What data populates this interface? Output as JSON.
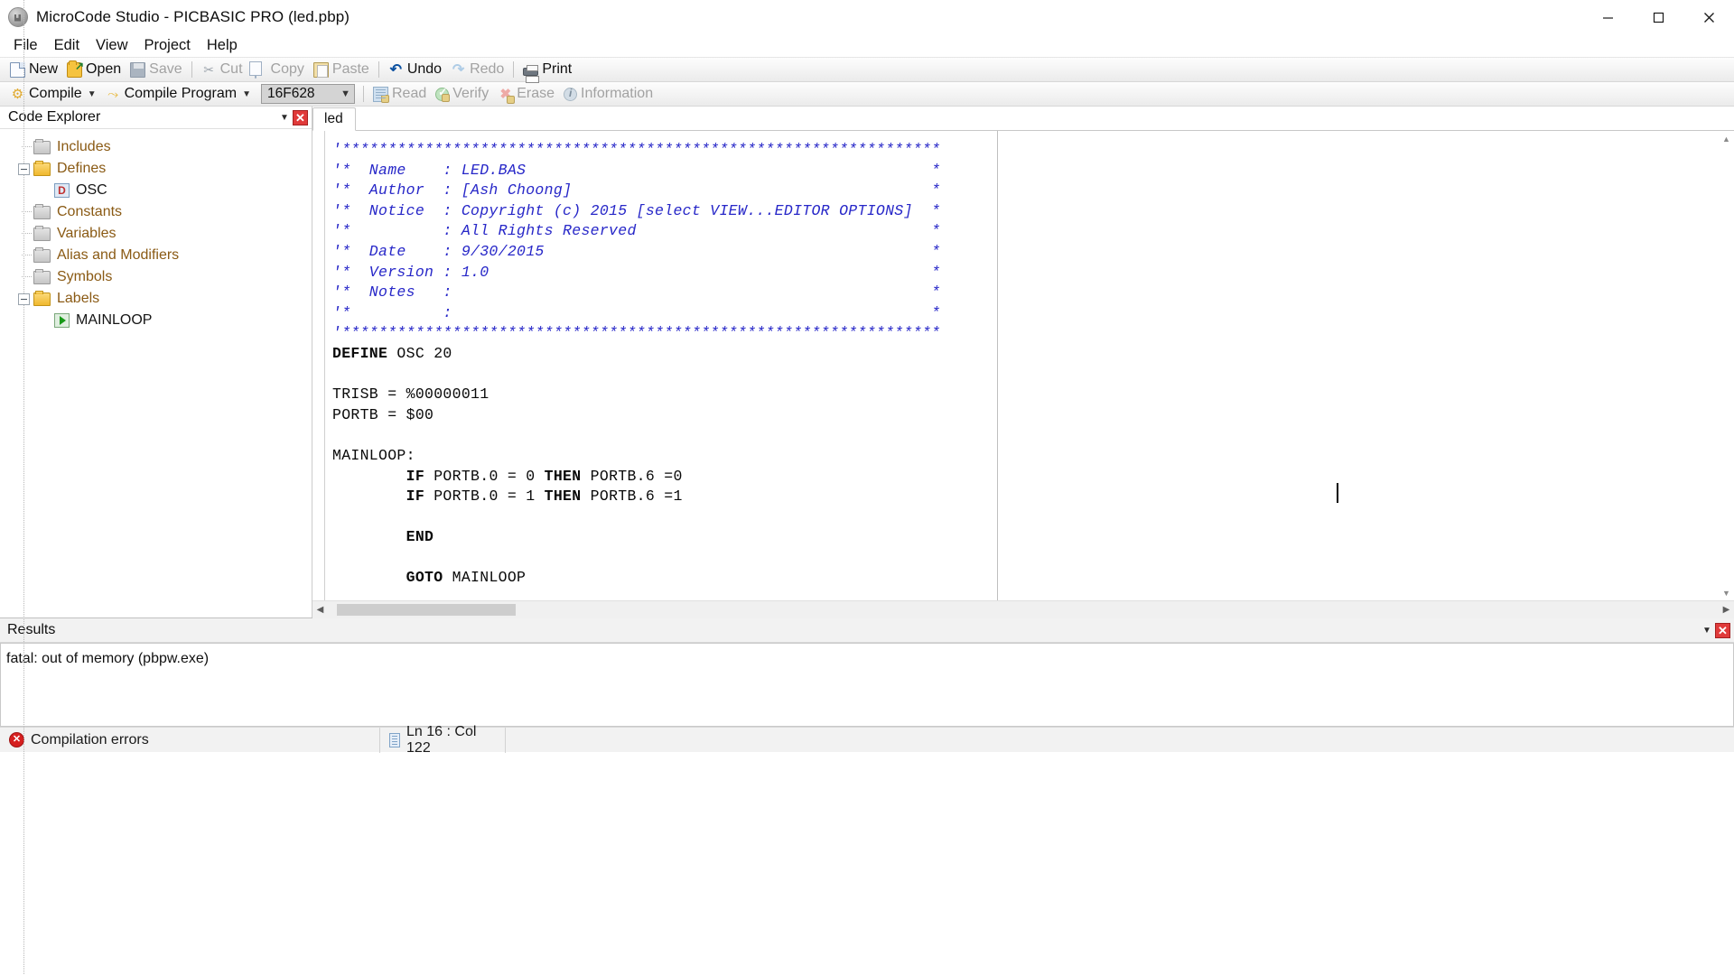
{
  "window": {
    "title": "MicroCode Studio - PICBASIC PRO (led.pbp)",
    "app_icon": "app-icon",
    "minimize": "─",
    "maximize": "☐",
    "close": "✕"
  },
  "menubar": {
    "items": [
      {
        "label": "File"
      },
      {
        "label": "Edit"
      },
      {
        "label": "View"
      },
      {
        "label": "Project"
      },
      {
        "label": "Help"
      }
    ]
  },
  "toolbar_main": {
    "items": [
      {
        "label": "New",
        "icon": "new-document-icon",
        "enabled": true
      },
      {
        "label": "Open",
        "icon": "open-folder-icon",
        "enabled": true
      },
      {
        "label": "Save",
        "icon": "save-disk-icon",
        "enabled": false
      },
      {
        "label": "Cut",
        "icon": "scissors-icon",
        "enabled": false
      },
      {
        "label": "Copy",
        "icon": "copy-icon",
        "enabled": false
      },
      {
        "label": "Paste",
        "icon": "clipboard-paste-icon",
        "enabled": false
      },
      {
        "label": "Undo",
        "icon": "undo-arrow-icon",
        "enabled": true
      },
      {
        "label": "Redo",
        "icon": "redo-arrow-icon",
        "enabled": false
      },
      {
        "label": "Print",
        "icon": "printer-icon",
        "enabled": true
      }
    ]
  },
  "toolbar_compile": {
    "compile": {
      "label": "Compile",
      "icon": "compile-gear-icon"
    },
    "compile_program": {
      "label": "Compile Program",
      "icon": "compile-program-icon"
    },
    "device": {
      "value": "16F628",
      "icon": "chevron-down-icon"
    },
    "items": [
      {
        "label": "Read",
        "icon": "read-chip-icon",
        "enabled": false
      },
      {
        "label": "Verify",
        "icon": "verify-check-icon",
        "enabled": false
      },
      {
        "label": "Erase",
        "icon": "erase-x-icon",
        "enabled": false
      },
      {
        "label": "Information",
        "icon": "information-icon",
        "enabled": false
      }
    ]
  },
  "explorer": {
    "title": "Code Explorer",
    "collapse_icon": "chevron-down-icon",
    "close_icon": "close-icon",
    "tree": [
      {
        "label": "Includes",
        "icon": "folder-icon",
        "state": "leaf",
        "depth": 0
      },
      {
        "label": "Defines",
        "icon": "folder-open-icon",
        "state": "expanded",
        "depth": 0
      },
      {
        "label": "OSC",
        "icon": "define-icon",
        "state": "leaf",
        "depth": 1
      },
      {
        "label": "Constants",
        "icon": "folder-icon",
        "state": "leaf",
        "depth": 0
      },
      {
        "label": "Variables",
        "icon": "folder-icon",
        "state": "leaf",
        "depth": 0
      },
      {
        "label": "Alias and Modifiers",
        "icon": "folder-icon",
        "state": "leaf",
        "depth": 0
      },
      {
        "label": "Symbols",
        "icon": "folder-icon",
        "state": "leaf",
        "depth": 0
      },
      {
        "label": "Labels",
        "icon": "folder-open-icon",
        "state": "expanded",
        "depth": 0
      },
      {
        "label": "MAINLOOP",
        "icon": "label-marker-icon",
        "state": "leaf",
        "depth": 1
      }
    ]
  },
  "editor": {
    "tabs": [
      {
        "label": "led",
        "active": true
      }
    ],
    "code_lines": [
      {
        "text": "'*****************************************************************",
        "type": "comment"
      },
      {
        "text": "'*  Name    : LED.BAS                                            *",
        "type": "comment"
      },
      {
        "text": "'*  Author  : [Ash Choong]                                       *",
        "type": "comment"
      },
      {
        "text": "'*  Notice  : Copyright (c) 2015 [select VIEW...EDITOR OPTIONS]  *",
        "type": "comment"
      },
      {
        "text": "'*          : All Rights Reserved                                *",
        "type": "comment"
      },
      {
        "text": "'*  Date    : 9/30/2015                                          *",
        "type": "comment"
      },
      {
        "text": "'*  Version : 1.0                                                *",
        "type": "comment"
      },
      {
        "text": "'*  Notes   :                                                    *",
        "type": "comment"
      },
      {
        "text": "'*          :                                                    *",
        "type": "comment"
      },
      {
        "text": "'*****************************************************************",
        "type": "comment"
      },
      {
        "text": "DEFINE OSC 20",
        "type": "code",
        "keyword": "DEFINE"
      },
      {
        "text": "",
        "type": "blank"
      },
      {
        "text": "TRISB = %00000011",
        "type": "code"
      },
      {
        "text": "PORTB = $00",
        "type": "code"
      },
      {
        "text": "",
        "type": "blank"
      },
      {
        "text": "MAINLOOP:",
        "type": "code"
      },
      {
        "text": "        IF PORTB.0 = 0 THEN PORTB.6 =0",
        "type": "code"
      },
      {
        "text": "        IF PORTB.0 = 1 THEN PORTB.6 =1",
        "type": "code"
      },
      {
        "text": "",
        "type": "blank"
      },
      {
        "text": "        END",
        "type": "code"
      },
      {
        "text": "",
        "type": "blank"
      },
      {
        "text": "        GOTO MAINLOOP",
        "type": "code"
      }
    ],
    "scroll_left_icon": "chevron-left-icon",
    "scroll_right_icon": "chevron-right-icon"
  },
  "results": {
    "title": "Results",
    "collapse_icon": "chevron-down-icon",
    "close_icon": "close-icon",
    "lines": [
      "fatal: out of memory (pbpw.exe)"
    ]
  },
  "statusbar": {
    "status_icon": "error-icon",
    "status_text": "Compilation errors",
    "position_icon": "line-position-icon",
    "position_text": "Ln 16 : Col 122"
  },
  "colors": {
    "comment": "#2727c8",
    "code": "#0a0a0a",
    "tree_label": "#8a5a14",
    "error_red": "#d62020",
    "close_red": "#e03a3a",
    "chrome": "#f2f2f2"
  }
}
